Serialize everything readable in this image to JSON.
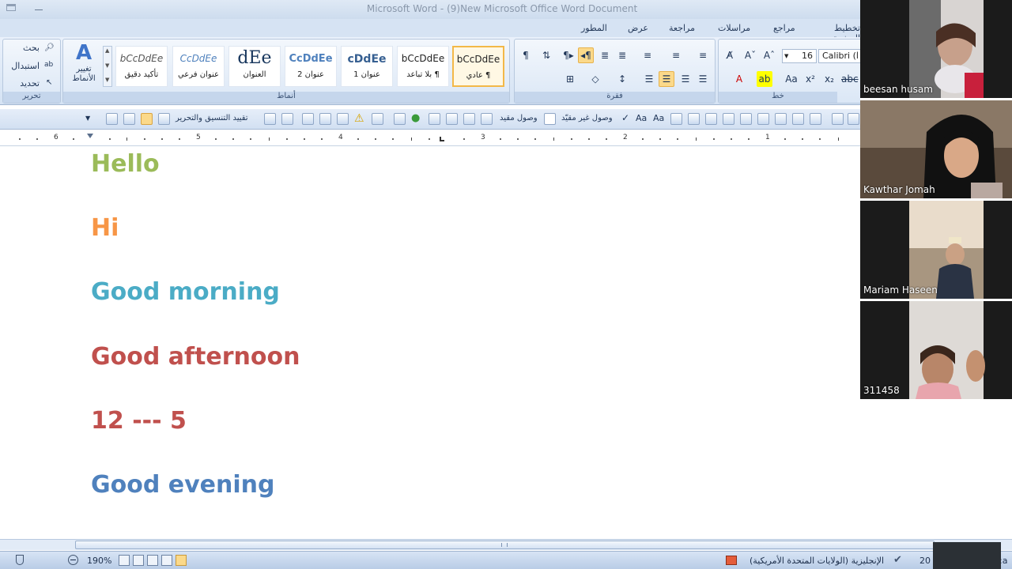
{
  "window": {
    "title": "Microsoft Word - (9)New Microsoft Office Word Document"
  },
  "ribbon_tabs": [
    {
      "label": "تخطيط الصفحة"
    },
    {
      "label": "مراجع"
    },
    {
      "label": "مراسلات"
    },
    {
      "label": "مراجعة"
    },
    {
      "label": "عرض"
    },
    {
      "label": "المطور"
    }
  ],
  "editing_group": {
    "label": "تحرير",
    "find": "بحث",
    "replace": "استبدال",
    "select": "تحديد"
  },
  "styles_group": {
    "label": "أنماط",
    "change_styles": "تغيير الأنماط",
    "styles": [
      {
        "sample": "bCcDdEe",
        "name": "تأكيد دقيق"
      },
      {
        "sample": "CcDdEe",
        "name": "عنوان فرعي"
      },
      {
        "sample": "dEe",
        "name": "العنوان"
      },
      {
        "sample": "CcDdEe",
        "name": "عنوان 2"
      },
      {
        "sample": "cDdEe",
        "name": "عنوان 1"
      },
      {
        "sample": "bCcDdEe",
        "name": "¶ بلا تباعد"
      },
      {
        "sample": "bCcDdEe",
        "name": "¶ عادي"
      }
    ]
  },
  "paragraph_group": {
    "label": "فقرة"
  },
  "font_group": {
    "label": "خط",
    "font_size": "16",
    "font_name": "Calibri (ا"
  },
  "toolbar2": {
    "restrict": "تقييد التنسيق والتحرير",
    "connect": "وصول مقيد",
    "connect_unrestricted": "وصول غير مقيّد"
  },
  "ruler": {
    "numbers": [
      "6",
      "5",
      "4",
      "3",
      "2",
      "1"
    ]
  },
  "document": {
    "lines": [
      {
        "text": "Hello",
        "color": "#9bbb59"
      },
      {
        "text": "Hi",
        "color": "#f79646"
      },
      {
        "text": "Good morning",
        "color": "#4bacc6"
      },
      {
        "text": "Good afternoon",
        "color": "#c0504d"
      },
      {
        "text": "12 --- 5",
        "color": "#c0504d"
      },
      {
        "text": "Good evening",
        "color": "#4f81bd"
      }
    ]
  },
  "statusbar": {
    "zoom": "190%",
    "language": "الإنجليزية (الولايات المتحدة الأمريكية)",
    "page_count": "20",
    "words_label": ":a"
  },
  "participants": [
    {
      "name": "beesan husam"
    },
    {
      "name": "Kawthar Jomah"
    },
    {
      "name": "Mariam Haseen"
    },
    {
      "name": "311458"
    }
  ]
}
